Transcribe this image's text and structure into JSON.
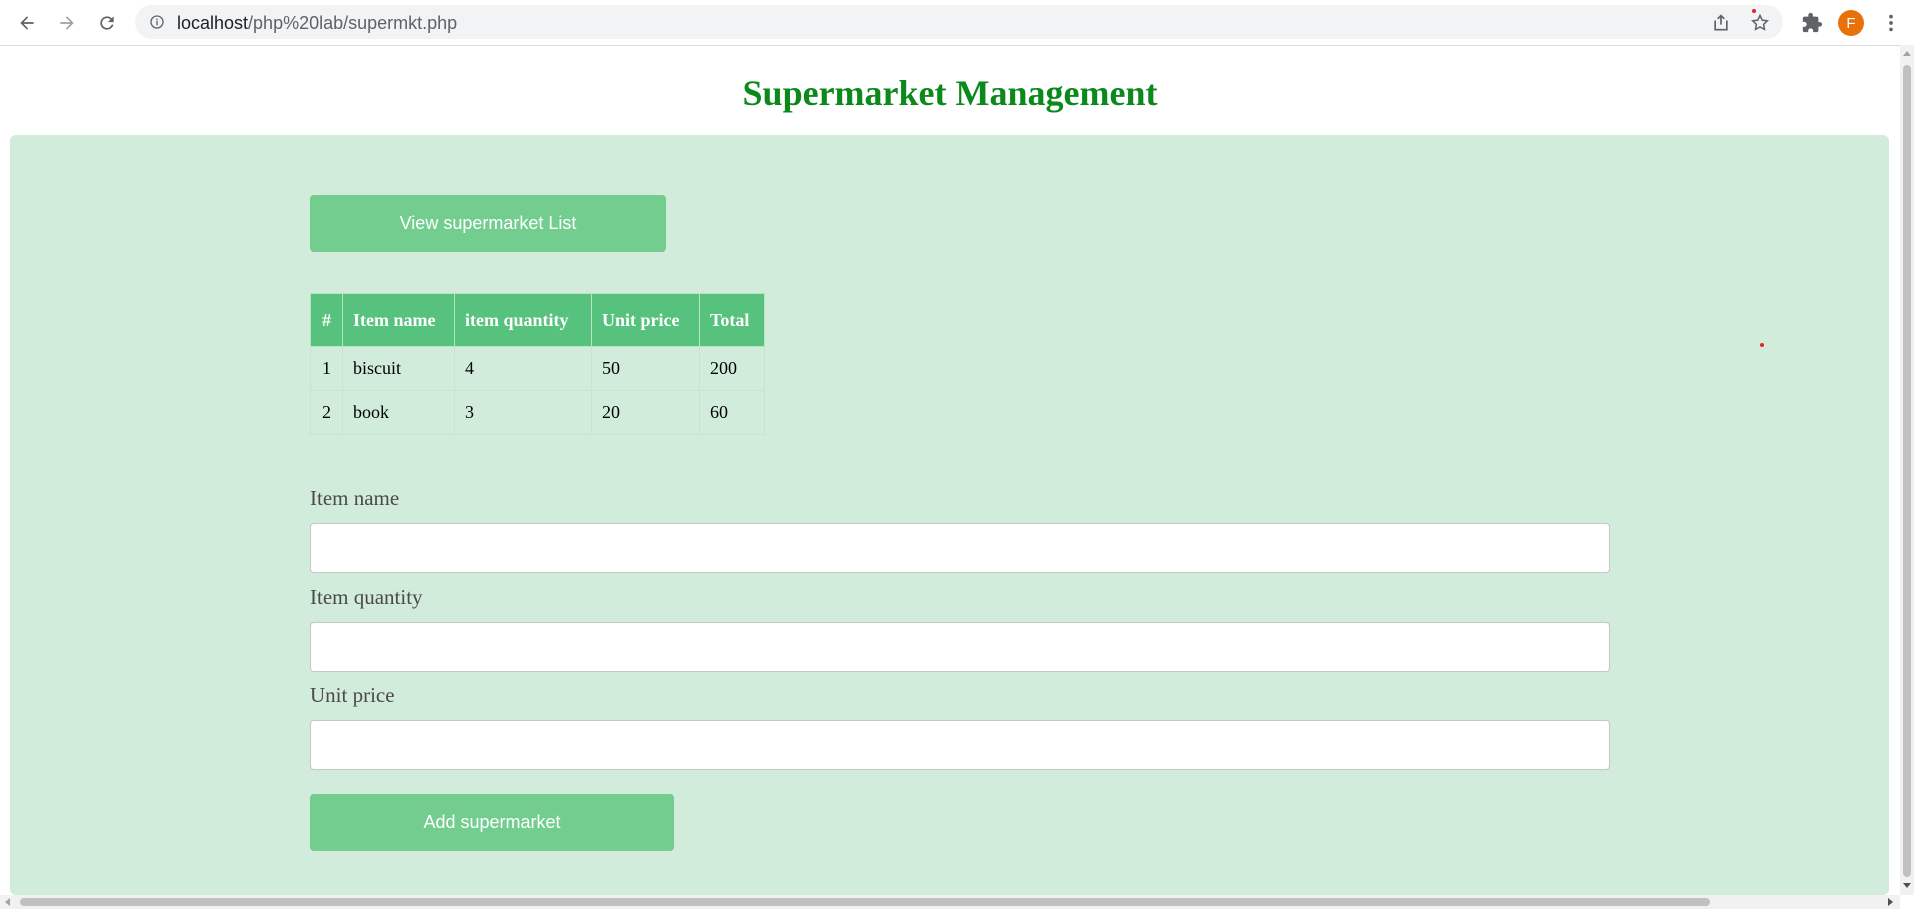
{
  "browser": {
    "url_host": "localhost",
    "url_path": "/php%20lab/supermkt.php",
    "avatar_letter": "F"
  },
  "page": {
    "title": "Supermarket Management",
    "view_button": "View supermarket List",
    "add_button": "Add supermarket"
  },
  "table": {
    "headers": [
      "#",
      "Item name",
      "item quantity",
      "Unit price",
      "Total"
    ],
    "rows": [
      [
        "1",
        "biscuit",
        "4",
        "50",
        "200"
      ],
      [
        "2",
        "book",
        "3",
        "20",
        "60"
      ]
    ]
  },
  "form": {
    "item_name_label": "Item name",
    "item_quantity_label": "Item quantity",
    "unit_price_label": "Unit price",
    "item_name_value": "",
    "item_quantity_value": "",
    "unit_price_value": ""
  },
  "colors": {
    "title": "#0b8a1b",
    "panel_bg": "#d2ecdb",
    "button_bg": "#72cd8f",
    "table_header_bg": "#57c27e",
    "avatar_bg": "#e8710a"
  },
  "icons": {
    "back": "arrow-left-icon",
    "forward": "arrow-right-icon",
    "reload": "reload-icon",
    "info": "info-icon",
    "share": "share-icon",
    "bookmark": "star-icon",
    "extensions": "puzzle-icon",
    "menu": "kebab-menu-icon"
  }
}
